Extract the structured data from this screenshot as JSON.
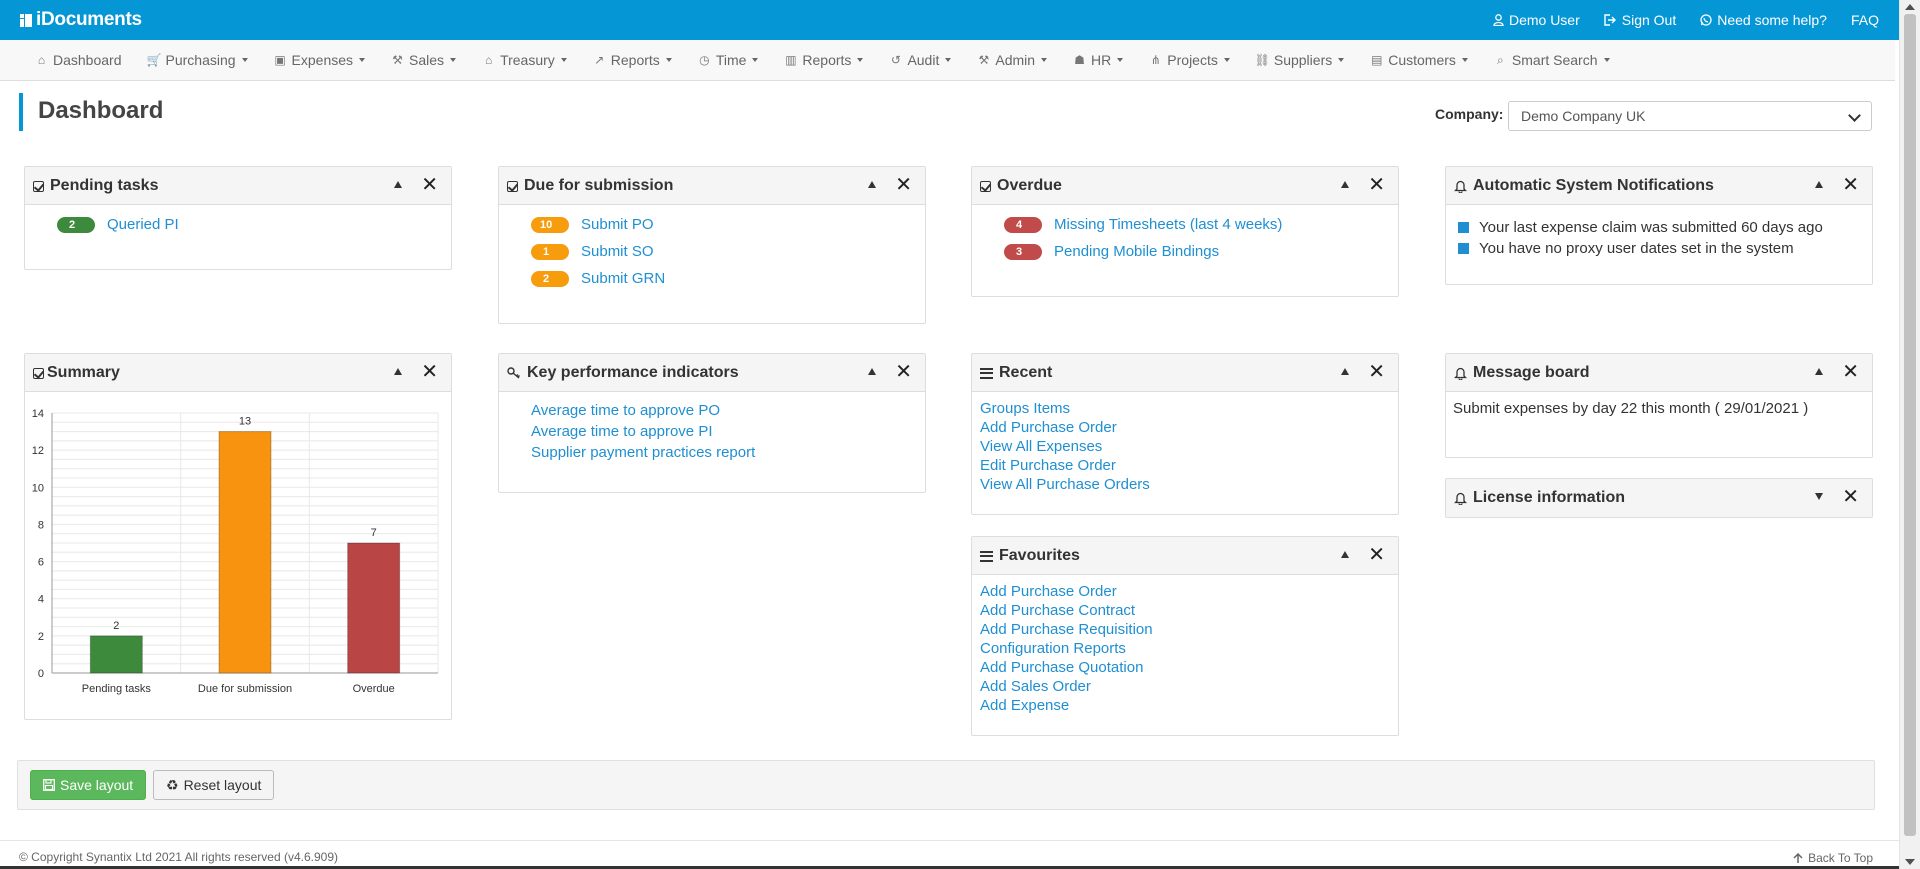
{
  "brand": {
    "name": "iDocuments"
  },
  "top_links": [
    {
      "label": "Demo User",
      "icon": "user-icon"
    },
    {
      "label": "Sign Out",
      "icon": "sign-out-icon"
    },
    {
      "label": "Need some help?",
      "icon": "whatsapp-icon"
    },
    {
      "label": "FAQ",
      "icon": ""
    }
  ],
  "nav": [
    {
      "label": "Dashboard",
      "icon": "home-icon",
      "caret": false
    },
    {
      "label": "Purchasing",
      "icon": "cart-icon",
      "caret": true
    },
    {
      "label": "Expenses",
      "icon": "money-icon",
      "caret": true
    },
    {
      "label": "Sales",
      "icon": "gavel-icon",
      "caret": true
    },
    {
      "label": "Treasury",
      "icon": "bank-icon",
      "caret": true
    },
    {
      "label": "Reports",
      "icon": "line-chart-icon",
      "caret": true
    },
    {
      "label": "Time",
      "icon": "clock-icon",
      "caret": true
    },
    {
      "label": "Reports",
      "icon": "bar-chart-icon",
      "caret": true
    },
    {
      "label": "Audit",
      "icon": "history-icon",
      "caret": true
    },
    {
      "label": "Admin",
      "icon": "wrench-icon",
      "caret": true
    },
    {
      "label": "HR",
      "icon": "users-icon",
      "caret": true
    },
    {
      "label": "Projects",
      "icon": "sitemap-icon",
      "caret": true
    },
    {
      "label": "Suppliers",
      "icon": "handshake-icon",
      "caret": true
    },
    {
      "label": "Customers",
      "icon": "address-book-icon",
      "caret": true
    },
    {
      "label": "Smart Search",
      "icon": "search-icon",
      "caret": true
    }
  ],
  "page": {
    "title": "Dashboard"
  },
  "company": {
    "label": "Company:",
    "selected": "Demo Company UK"
  },
  "panels": {
    "pending": {
      "title": "Pending tasks",
      "items": [
        {
          "count": "2",
          "label": "Queried PI",
          "color": "#3e8a3d"
        }
      ]
    },
    "due": {
      "title": "Due for submission",
      "items": [
        {
          "count": "10",
          "label": "Submit PO"
        },
        {
          "count": "1",
          "label": "Submit SO"
        },
        {
          "count": "2",
          "label": "Submit GRN"
        }
      ]
    },
    "overdue": {
      "title": "Overdue",
      "items": [
        {
          "count": "4",
          "label": "Missing Timesheets (last 4 weeks)"
        },
        {
          "count": "3",
          "label": "Pending Mobile Bindings"
        }
      ]
    },
    "notifications": {
      "title": "Automatic System Notifications",
      "items": [
        "Your last expense claim was submitted 60 days ago",
        "You have no proxy user dates set in the system"
      ]
    },
    "summary": {
      "title": "Summary"
    },
    "kpi": {
      "title": "Key performance indicators",
      "links": [
        "Average time to approve PO",
        "Average time to approve PI",
        "Supplier payment practices report"
      ]
    },
    "recent": {
      "title": "Recent",
      "links": [
        "Groups Items",
        "Add Purchase Order",
        "View All Expenses",
        "Edit Purchase Order",
        "View All Purchase Orders"
      ]
    },
    "favourites": {
      "title": "Favourites",
      "links": [
        "Add Purchase Order",
        "Add Purchase Contract",
        "Add Purchase Requisition",
        "Configuration Reports",
        "Add Purchase Quotation",
        "Add Sales Order",
        "Add Expense"
      ]
    },
    "message": {
      "title": "Message board",
      "text": "Submit expenses by day 22 this month ( 29/01/2021 )"
    },
    "license": {
      "title": "License information"
    }
  },
  "chart_data": {
    "type": "bar",
    "categories": [
      "Pending tasks",
      "Due for submission",
      "Overdue"
    ],
    "values": [
      2,
      13,
      7
    ],
    "colors": [
      "#3e8a3d",
      "#f8930f",
      "#b94545"
    ],
    "ylim": [
      0,
      14
    ],
    "yticks": [
      0,
      2,
      4,
      6,
      8,
      10,
      12,
      14
    ],
    "grid": true,
    "title": "",
    "xlabel": "",
    "ylabel": ""
  },
  "buttons": {
    "save": "Save layout",
    "reset": "Reset layout"
  },
  "footer": {
    "copyright": "© Copyright Synantix Ltd 2021 All rights reserved (v4.6.909)",
    "back_to_top": "Back To Top"
  },
  "colors": {
    "primary": "#0596d6",
    "link": "#1f8fd2",
    "success": "#5cb85c"
  }
}
